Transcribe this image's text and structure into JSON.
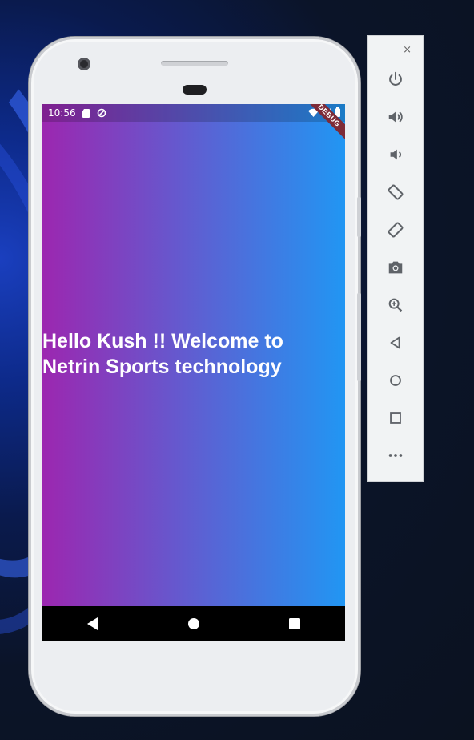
{
  "emulator_toolbar": {
    "minimize_label": "–",
    "close_label": "×",
    "buttons": [
      {
        "name": "power-icon"
      },
      {
        "name": "volume-up-icon"
      },
      {
        "name": "volume-down-icon"
      },
      {
        "name": "rotate-left-icon"
      },
      {
        "name": "rotate-right-icon"
      },
      {
        "name": "camera-icon"
      },
      {
        "name": "zoom-icon"
      },
      {
        "name": "back-icon"
      },
      {
        "name": "home-icon"
      },
      {
        "name": "overview-icon"
      },
      {
        "name": "more-icon"
      }
    ]
  },
  "status_bar": {
    "time": "10:56"
  },
  "debug_banner": "DEBUG",
  "app": {
    "welcome_text": "Hello Kush !! Welcome to Netrin Sports technology",
    "gradient_start": "#9c27b0",
    "gradient_end": "#2196f3"
  },
  "nav_bar": {
    "back": "back-triangle-icon",
    "home": "home-circle-icon",
    "recents": "recents-square-icon"
  }
}
